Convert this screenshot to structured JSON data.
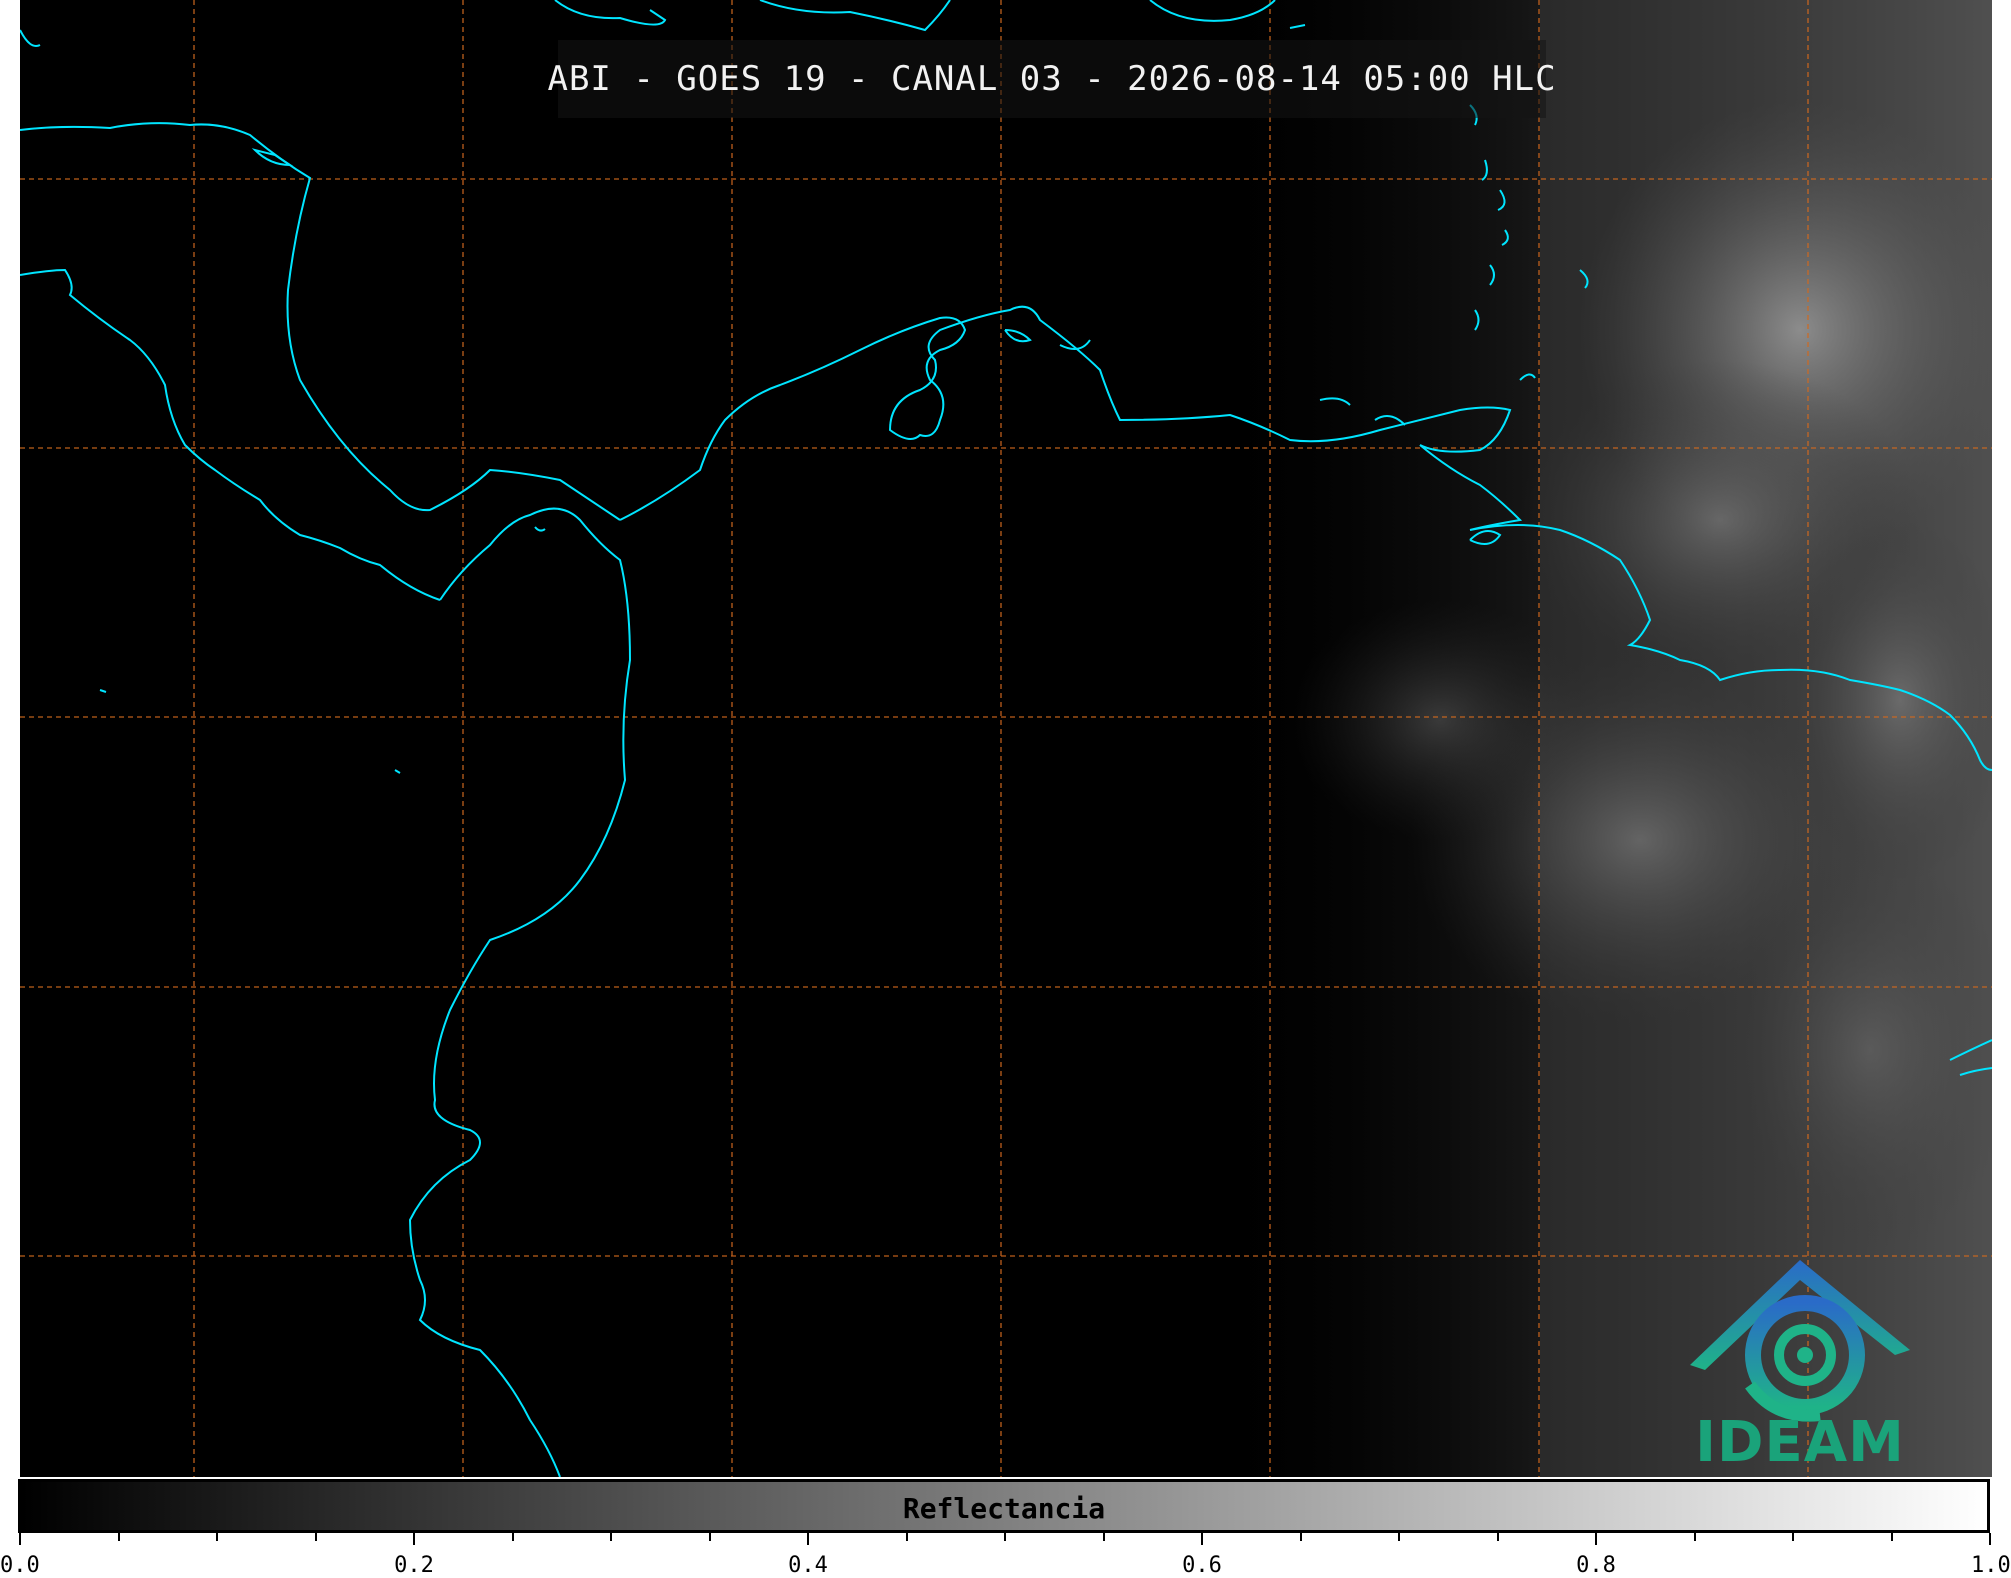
{
  "map": {
    "title": "ABI - GOES 19 - CANAL 03 - 2026-08-14 05:00 HLC",
    "coastline_color": "#00e5ff",
    "grid_color": "#d2691e",
    "background_color": "#000000",
    "cloud_color": "#8a8a8a"
  },
  "logo": {
    "text": "IDEAM",
    "icon": "ideam-logo-icon",
    "color": "#1aa37a"
  },
  "colorbar": {
    "label": "Reflectancia",
    "min": 0.0,
    "max": 1.0,
    "gradient": [
      "#000000",
      "#ffffff"
    ],
    "tick_labels": [
      "0.0",
      "0.2",
      "0.4",
      "0.6",
      "0.8",
      "1.0"
    ]
  }
}
